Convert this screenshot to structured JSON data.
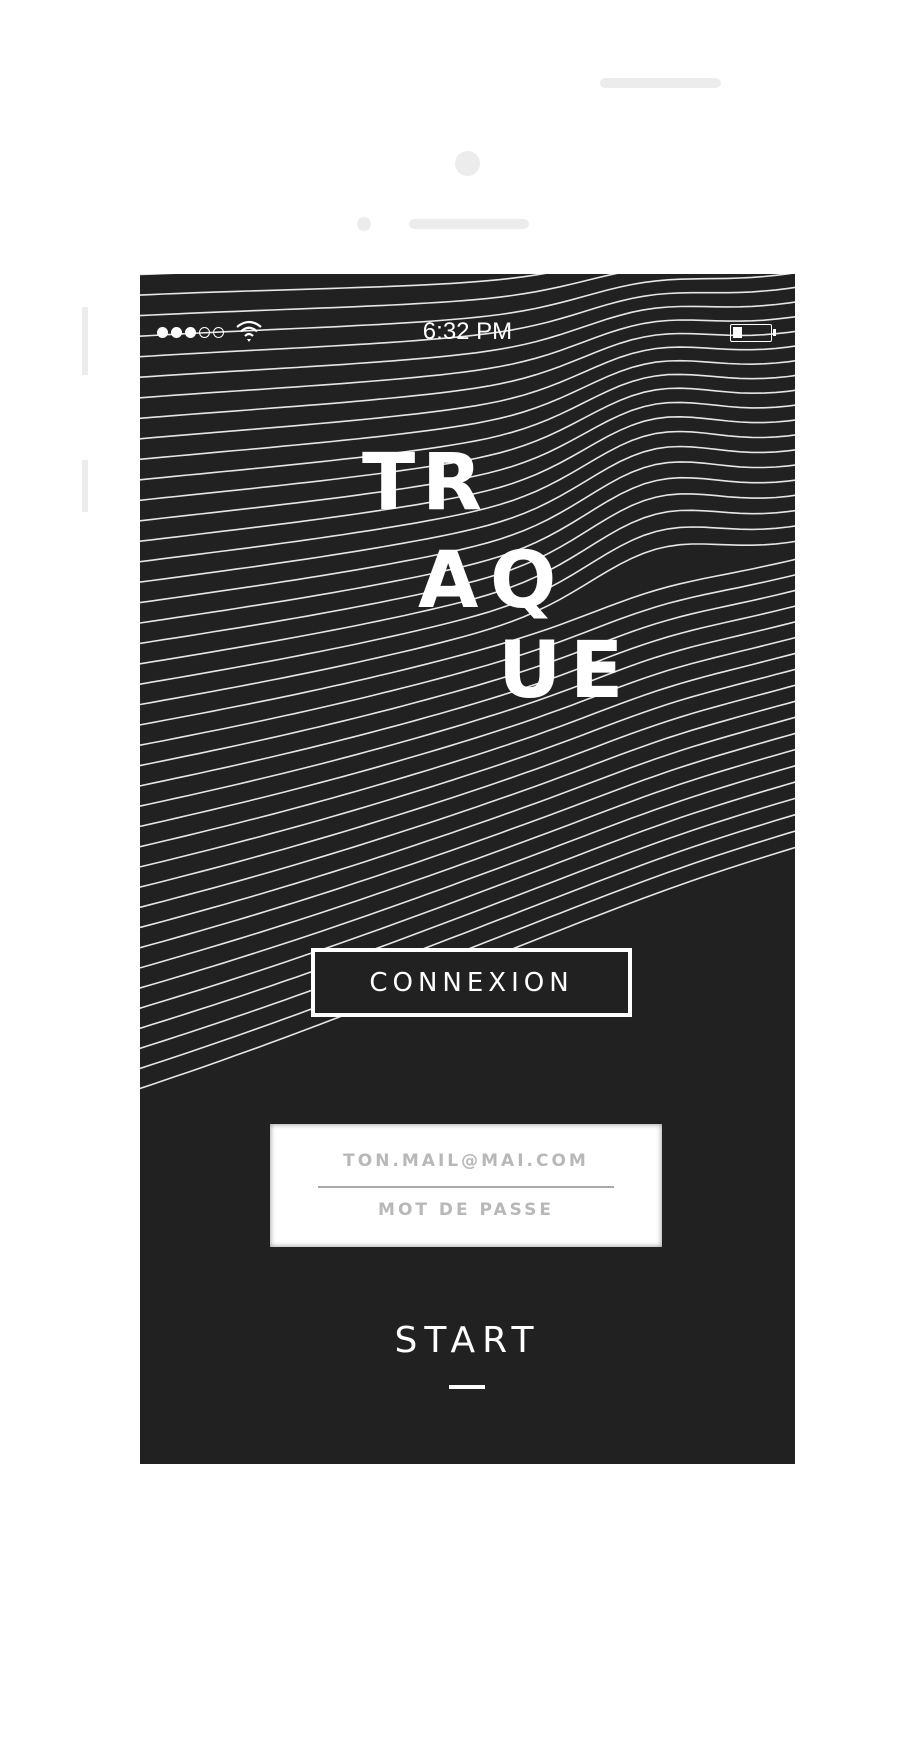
{
  "status_bar": {
    "time": "6:32 PM",
    "signal_bars_filled": 3,
    "signal_bars_total": 5,
    "wifi_icon": "wifi-icon",
    "battery_icon": "battery-icon",
    "battery_level": 0.25
  },
  "logo": {
    "letters": [
      "T",
      "R",
      "A",
      "Q",
      "U",
      "E"
    ]
  },
  "connexion": {
    "label": "CONNEXION"
  },
  "login": {
    "email_placeholder": "TON.MAIL@MAI.COM",
    "password_placeholder": "MOT DE PASSE"
  },
  "start": {
    "label": "START"
  },
  "colors": {
    "background": "#212121",
    "foreground": "#ffffff",
    "placeholder": "#b8b8b8"
  }
}
